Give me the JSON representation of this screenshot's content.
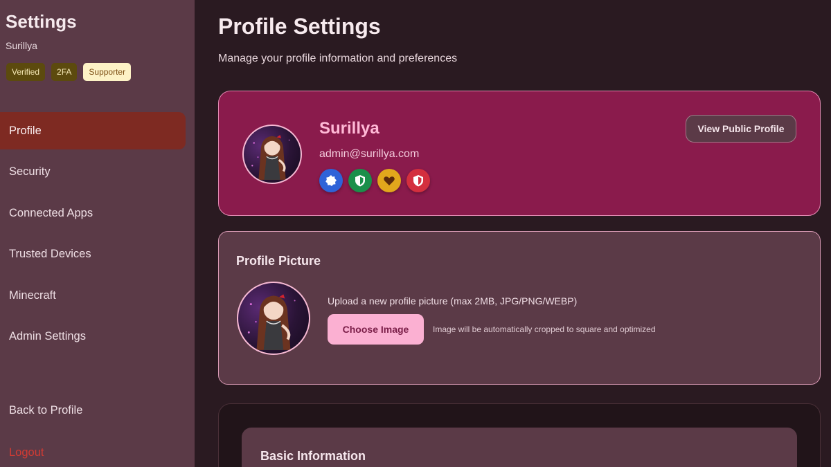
{
  "sidebar": {
    "title": "Settings",
    "username": "Surillya",
    "badges": [
      {
        "label": "Verified"
      },
      {
        "label": "2FA"
      },
      {
        "label": "Supporter"
      }
    ],
    "nav": [
      {
        "label": "Profile",
        "active": true
      },
      {
        "label": "Security"
      },
      {
        "label": "Connected Apps"
      },
      {
        "label": "Trusted Devices"
      },
      {
        "label": "Minecraft"
      },
      {
        "label": "Admin Settings"
      }
    ],
    "back_label": "Back to Profile",
    "logout_label": "Logout"
  },
  "main": {
    "title": "Profile Settings",
    "subtitle": "Manage your profile information and preferences",
    "hero": {
      "name": "Surillya",
      "email": "admin@surillya.com",
      "icons": [
        "verified-badge-icon",
        "shield-icon",
        "heart-icon",
        "shield-alert-icon"
      ],
      "view_button": "View Public Profile"
    },
    "picture_card": {
      "title": "Profile Picture",
      "upload_text": "Upload a new profile picture (max 2MB, JPG/PNG/WEBP)",
      "choose_button": "Choose Image",
      "crop_note": "Image will be automatically cropped to square and optimized"
    },
    "basic_info": {
      "title": "Basic Information"
    }
  },
  "colors": {
    "sidebar_bg": "#5b3a47",
    "page_bg": "#2a1a21",
    "active_nav": "#7e2a22",
    "hero_bg": "#8a1b4c",
    "accent_pink": "#fbb0d2",
    "logout_red": "#d23b33"
  }
}
